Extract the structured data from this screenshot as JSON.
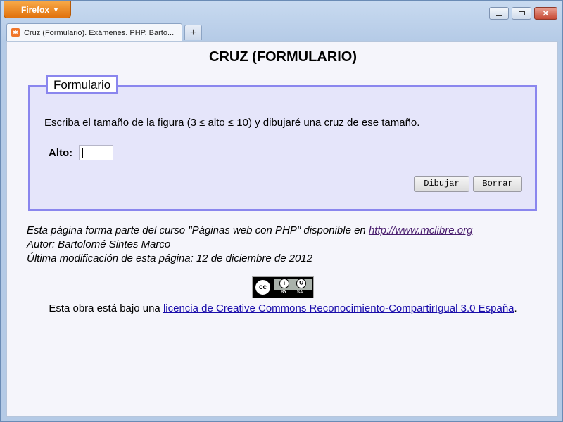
{
  "browser": {
    "app_button": "Firefox",
    "tab_title": "Cruz (Formulario). Exámenes. PHP. Barto...",
    "new_tab": "+"
  },
  "page": {
    "title": "CRUZ (FORMULARIO)",
    "legend": "Formulario",
    "description": "Escriba el tamaño de la figura (3 ≤ alto ≤ 10) y dibujaré una cruz de ese tamaño.",
    "alto_label": "Alto:",
    "alto_value": "",
    "draw_button": "Dibujar",
    "reset_button": "Borrar"
  },
  "footer": {
    "line1_prefix": "Esta página forma parte del curso \"Páginas web con PHP\" disponible en ",
    "line1_link": "http://www.mclibre.org",
    "line2": "Autor: Bartolomé Sintes Marco",
    "line3": "Última modificación de esta página: 12 de diciembre de 2012",
    "license_prefix": "Esta obra está bajo una ",
    "license_link": "licencia de Creative Commons Reconocimiento-CompartirIgual 3.0 España",
    "license_suffix": ".",
    "cc_badge": {
      "cc": "cc",
      "by": "BY",
      "sa": "SA"
    }
  }
}
